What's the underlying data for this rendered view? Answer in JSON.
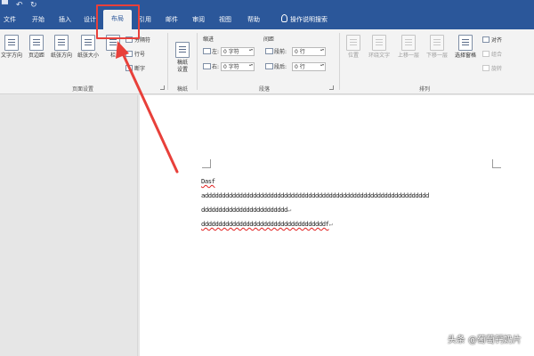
{
  "tabs": [
    {
      "label": "文件",
      "name": "tab-file"
    },
    {
      "label": "开始",
      "name": "tab-home"
    },
    {
      "label": "插入",
      "name": "tab-insert"
    },
    {
      "label": "设计",
      "name": "tab-design"
    },
    {
      "label": "布局",
      "name": "tab-layout",
      "active": true
    },
    {
      "label": "引用",
      "name": "tab-references"
    },
    {
      "label": "邮件",
      "name": "tab-mailings"
    },
    {
      "label": "审阅",
      "name": "tab-review"
    },
    {
      "label": "视图",
      "name": "tab-view"
    },
    {
      "label": "帮助",
      "name": "tab-help"
    }
  ],
  "search": {
    "label": "操作说明搜索",
    "icon": "lightbulb-icon"
  },
  "ribbon": {
    "page_setup": {
      "label": "页面设置",
      "text_direction": "文字方向",
      "margins": "页边距",
      "orientation": "纸张方向",
      "size": "纸张大小",
      "columns": "栏",
      "breaks": "分隔符",
      "line_numbers": "行号",
      "hyphenation": "断字"
    },
    "manuscript": {
      "label": "稿纸",
      "button": "稿纸\n设置"
    },
    "paragraph": {
      "label": "段落",
      "indent_label": "缩进",
      "spacing_label": "间距",
      "left": "左:",
      "right": "右:",
      "before": "段前:",
      "after": "段后:",
      "left_value": "0 字符",
      "right_value": "0 字符",
      "before_value": "0 行",
      "after_value": "0 行"
    },
    "arrange": {
      "label": "排列",
      "position": "位置",
      "wrap_text": "环绕文字",
      "bring_forward": "上移一层",
      "send_backward": "下移一层",
      "selection_pane": "选择窗格",
      "align": "对齐",
      "group": "组合",
      "rotate": "旋转"
    }
  },
  "document": {
    "line1": "Dasf",
    "line2": "addddddddddddddddddddddddddddddddddddddddddddddddddddddddddddddddd",
    "line3": "ddddddddddddddddddddddddd",
    "line4": "ddddddddddddddddddddddddddddddddddddf",
    "mark": "↵"
  },
  "watermark": "头条 @葡萄钙奶片",
  "colors": {
    "ribbon_blue": "#2b579a",
    "annotation_red": "#e8403a"
  }
}
